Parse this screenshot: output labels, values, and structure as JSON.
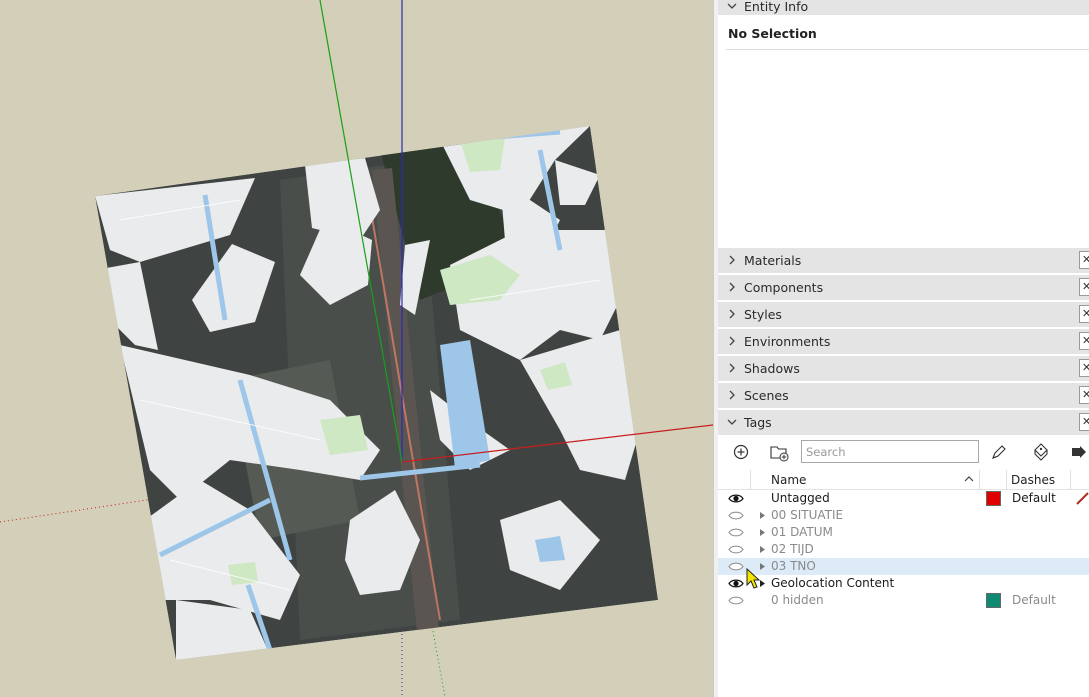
{
  "panel": {
    "entity_info": {
      "label": "Entity Info",
      "no_selection": "No Selection"
    },
    "trays": [
      {
        "label": "Materials"
      },
      {
        "label": "Components"
      },
      {
        "label": "Styles"
      },
      {
        "label": "Environments"
      },
      {
        "label": "Shadows"
      },
      {
        "label": "Scenes"
      },
      {
        "label": "Tags"
      }
    ],
    "close_glyph": "✕",
    "tags": {
      "search_placeholder": "Search",
      "columns": {
        "name": "Name",
        "dashes": "Dashes"
      },
      "rows": [
        {
          "name": "Untagged",
          "visible": true,
          "expandable": false,
          "swatch": "#e00000",
          "dashes": "Default"
        },
        {
          "name": "00 SITUATIE",
          "visible": false,
          "expandable": true
        },
        {
          "name": "01 DATUM",
          "visible": false,
          "expandable": true
        },
        {
          "name": "02 TIJD",
          "visible": false,
          "expandable": true
        },
        {
          "name": "03 TNO",
          "visible": false,
          "expandable": true,
          "highlighted": true
        },
        {
          "name": "Geolocation Content",
          "visible": true,
          "expandable": true
        },
        {
          "name": "0 hidden",
          "visible": false,
          "expandable": false,
          "swatch": "#0e8a72",
          "dashes": "Default"
        }
      ]
    }
  },
  "colors": {
    "sky_ground": "#d3cfb8",
    "axis_red": "#c81e1e",
    "axis_green": "#19a019",
    "axis_blue": "#2a2ab8",
    "row_highlight": "#dcebf7"
  }
}
